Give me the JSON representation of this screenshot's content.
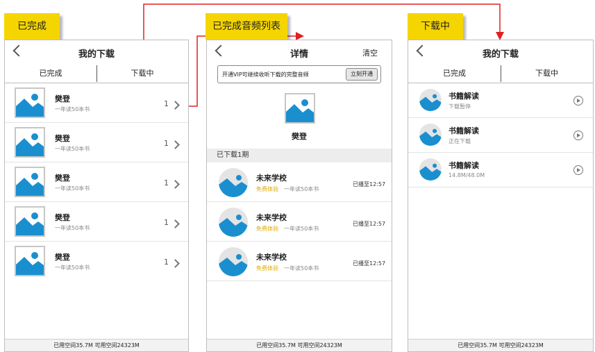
{
  "colors": {
    "accent_yellow": "#f5d500",
    "arrow_red": "#e02020",
    "image_blue": "#1a8fd0",
    "free_label": "#e0a800"
  },
  "labels": {
    "completed": "已完成",
    "completed_audio_list": "已完成音频列表",
    "downloading": "下载中"
  },
  "screen1": {
    "back_icon": "chevron-left-icon",
    "title": "我的下载",
    "tab_done": "已完成",
    "tab_downloading": "下载中",
    "items": [
      {
        "name": "樊登",
        "desc": "一年读50本书",
        "count": "1"
      },
      {
        "name": "樊登",
        "desc": "一年读50本书",
        "count": "1"
      },
      {
        "name": "樊登",
        "desc": "一年读50本书",
        "count": "1"
      },
      {
        "name": "樊登",
        "desc": "一年读50本书",
        "count": "1"
      },
      {
        "name": "樊登",
        "desc": "一年读50本书",
        "count": "1"
      }
    ],
    "footer": "已用空间35.7M  可用空间24323M"
  },
  "screen2": {
    "title": "详情",
    "clear": "清空",
    "vip_text": "开通VIP可继续收听下载的完整音频",
    "vip_button": "立刻开通",
    "author": "樊登",
    "section": "已下载1期",
    "items": [
      {
        "name": "未来学校",
        "free": "免费体验",
        "desc": "一年读50本书",
        "time": "已播至12:57"
      },
      {
        "name": "未来学校",
        "free": "免费体验",
        "desc": "一年读50本书",
        "time": "已播至12:57"
      },
      {
        "name": "未来学校",
        "free": "免费体验",
        "desc": "一年读50本书",
        "time": "已播至12:57"
      }
    ],
    "footer": "已用空间35.7M  可用空间24323M"
  },
  "screen3": {
    "title": "我的下载",
    "tab_done": "已完成",
    "tab_downloading": "下载中",
    "items": [
      {
        "name": "书籍解读",
        "status": "下载暂停"
      },
      {
        "name": "书籍解读",
        "status": "正在下载"
      },
      {
        "name": "书籍解读",
        "status": "14.8M/48.0M"
      }
    ],
    "footer": "已用空间35.7M  可用空间24323M"
  }
}
